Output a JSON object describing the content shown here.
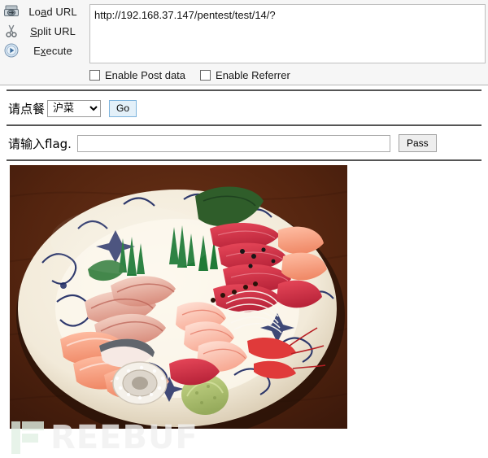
{
  "hackbar": {
    "actions": [
      {
        "icon": "load-url-icon",
        "label_pre": "Lo",
        "label_key": "a",
        "label_post": "d URL",
        "name": "load-url"
      },
      {
        "icon": "scissors-icon",
        "label_pre": "",
        "label_key": "S",
        "label_post": "plit URL",
        "name": "split-url"
      },
      {
        "icon": "play-icon",
        "label_pre": "E",
        "label_key": "x",
        "label_post": "ecute",
        "name": "execute"
      }
    ],
    "url_value": "http://192.168.37.147/pentest/test/14/?",
    "url_placeholder": "",
    "checkboxes": [
      {
        "label": "Enable Post data",
        "checked": false,
        "name": "enable-post-data"
      },
      {
        "label": "Enable Referrer",
        "checked": false,
        "name": "enable-referrer"
      }
    ]
  },
  "page": {
    "order_row": {
      "label": "请点餐",
      "select_value": "沪菜",
      "select_options": [
        "沪菜"
      ],
      "button_label": "Go"
    },
    "flag_row": {
      "label": "请输入flag.",
      "input_value": "",
      "input_placeholder": "",
      "button_label": "Pass"
    },
    "photo": {
      "alt": "sashimi-platter-photo"
    },
    "watermark": {
      "text": "REEBUF",
      "logo": "freebuf-f-logo",
      "color": "#f0f0f0"
    }
  },
  "colors": {
    "panel_bg": "#f6f6f6",
    "panel_border": "#b5b5b5",
    "rule": "#555555",
    "go_button_bg": "#e3f0f9",
    "go_button_border": "#7eb4dd",
    "pass_button_bg": "#eeeeee"
  }
}
